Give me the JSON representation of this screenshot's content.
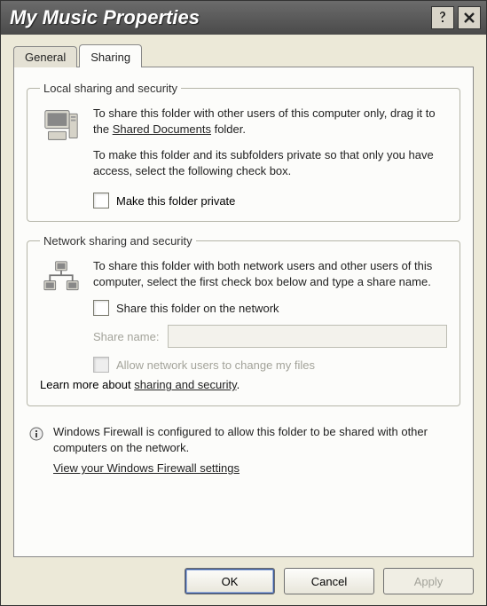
{
  "titlebar": {
    "title": "My Music Properties"
  },
  "tabs": {
    "general": "General",
    "sharing": "Sharing"
  },
  "local": {
    "legend": "Local sharing and security",
    "line1_pre": "To share this folder with other users of this computer only, drag it to the ",
    "shared_docs": "Shared Documents",
    "line1_post": " folder.",
    "line2": "To make this folder and its subfolders private so that only you have access, select the following check box.",
    "make_private": "Make this folder private"
  },
  "network": {
    "legend": "Network sharing and security",
    "line1": "To share this folder with both network users and other users of this computer, select the first check box below and type a share name.",
    "share_cb": "Share this folder on the network",
    "share_name_label": "Share name:",
    "share_name_value": "",
    "allow_cb": "Allow network users to change my files",
    "learn_pre": "Learn more about ",
    "learn_link": "sharing and security",
    "learn_post": "."
  },
  "firewall": {
    "text": "Windows Firewall is configured to allow this folder to be shared with other computers on the network.",
    "link": "View your Windows Firewall settings"
  },
  "buttons": {
    "ok": "OK",
    "cancel": "Cancel",
    "apply": "Apply"
  }
}
